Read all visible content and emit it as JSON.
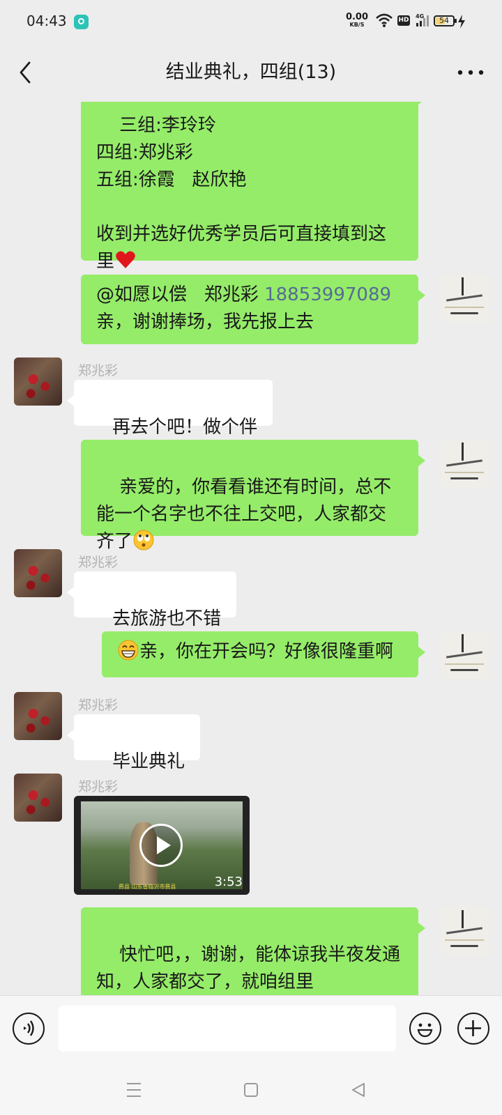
{
  "status_bar": {
    "time": "04:43",
    "net_speed": "0.00",
    "net_speed_unit": "KB/S",
    "hd": "HD",
    "network": "4G",
    "battery": "54",
    "battery_level": 0.54
  },
  "header": {
    "title": "结业典礼，四组(13)"
  },
  "messages": [
    {
      "side": "me",
      "text": "三组:李玲玲\n四组:郑兆彩\n五组:徐霞   赵欣艳\n\n收到并选好优秀学员后可直接填到这里"
    },
    {
      "side": "me",
      "mention": "@如愿以偿   郑兆彩 ",
      "phone": "18853997089",
      "text": "亲，谢谢捧场，我先报上去"
    },
    {
      "side": "them",
      "sender": "郑兆彩",
      "text": "再去个吧！做个伴"
    },
    {
      "side": "me",
      "text": "亲爱的，你看看谁还有时间，总不能一个名字也不往上交吧，人家都交齐了"
    },
    {
      "side": "them",
      "sender": "郑兆彩",
      "text": "去旅游也不错"
    },
    {
      "side": "me",
      "text": "亲，你在开会吗？好像很隆重啊"
    },
    {
      "side": "them",
      "sender": "郑兆彩",
      "text": "毕业典礼"
    },
    {
      "side": "them",
      "sender": "郑兆彩",
      "type": "video",
      "duration": "3:53",
      "caption": "费县   山东省临沂市费县"
    },
    {
      "side": "me",
      "text": "快忙吧，，谢谢，能体谅我半夜发通知，人家都交了，就咱组里"
    }
  ],
  "input": {
    "placeholder": ""
  },
  "colors": {
    "background": "#ededed",
    "bubble_me": "#95ec69",
    "bubble_them": "#ffffff",
    "link": "#576b95"
  },
  "icons": {
    "back": "back-icon",
    "more": "more-icon",
    "voice": "voice-icon",
    "emoji": "emoji-icon",
    "plus": "plus-icon",
    "heart": "heart-emoji",
    "rolling_eyes": "rolling-eyes-emoji",
    "grin": "grin-emoji"
  }
}
